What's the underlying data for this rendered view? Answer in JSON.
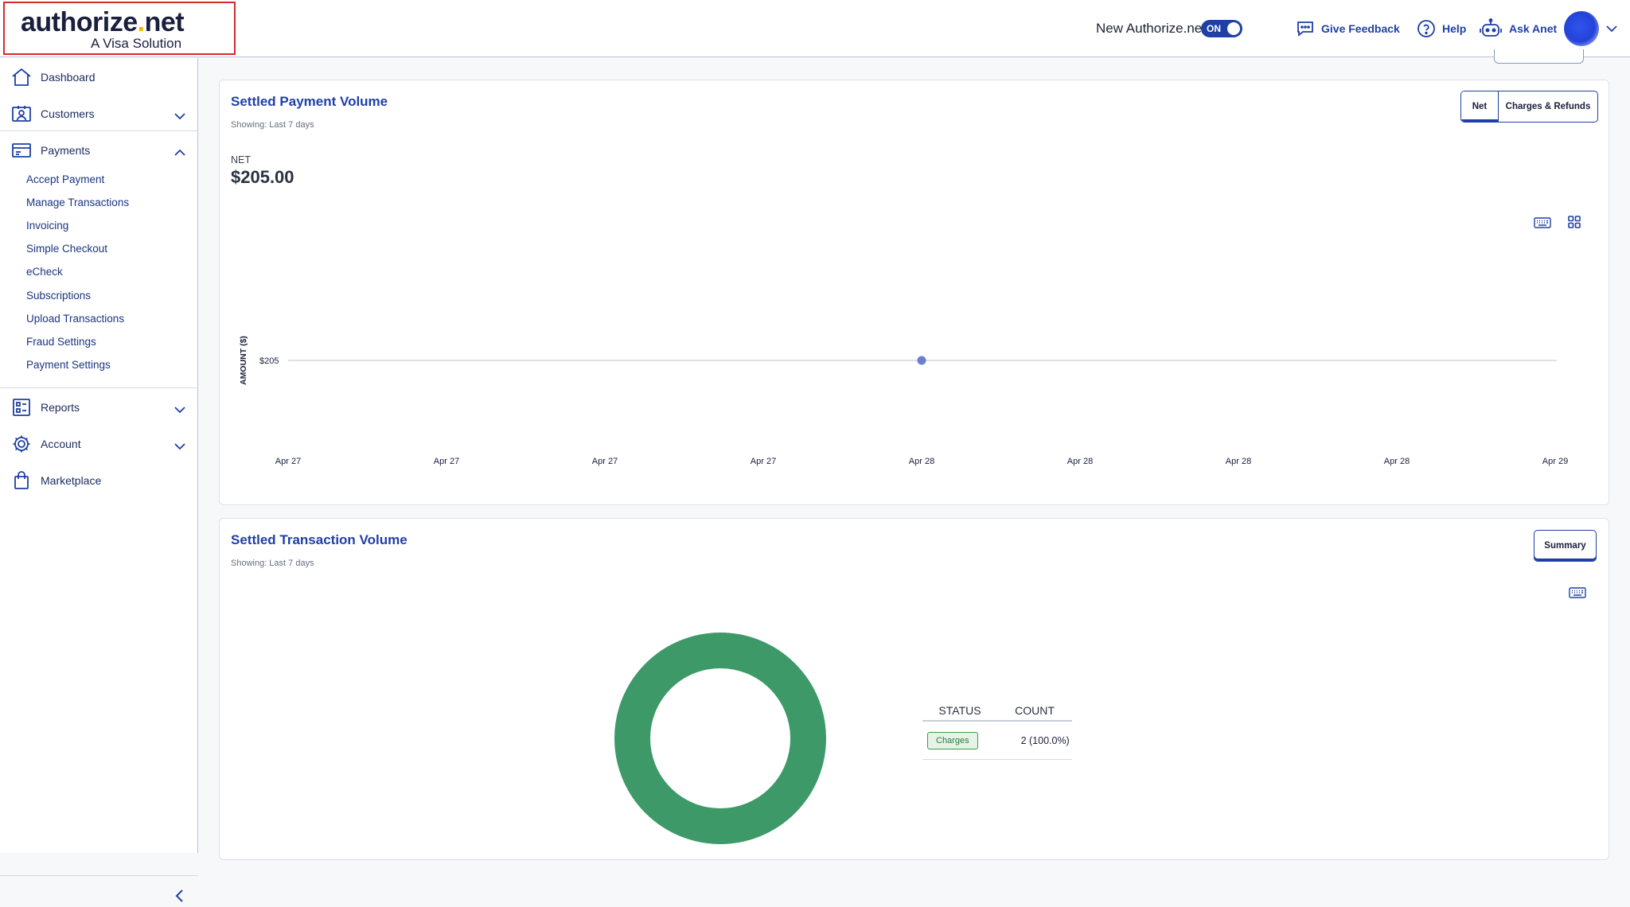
{
  "header": {
    "logo_main": "authorize",
    "logo_dot": ".",
    "logo_tld": "net",
    "logo_sub": "A Visa Solution",
    "toggle_label": "New Authorize.net",
    "toggle_state": "ON",
    "feedback": "Give Feedback",
    "help": "Help",
    "ask": "Ask Anet"
  },
  "sidebar": {
    "dashboard": "Dashboard",
    "customers": "Customers",
    "payments": "Payments",
    "payments_sub": [
      "Accept Payment",
      "Manage Transactions",
      "Invoicing",
      "Simple Checkout",
      "eCheck",
      "Subscriptions",
      "Upload Transactions",
      "Fraud Settings",
      "Payment Settings"
    ],
    "reports": "Reports",
    "account": "Account",
    "marketplace": "Marketplace"
  },
  "payment_volume": {
    "title": "Settled Payment Volume",
    "showing": "Showing: Last 7 days",
    "tab_net": "Net",
    "tab_charges": "Charges & Refunds",
    "net_label": "NET",
    "net_value": "$205.00"
  },
  "transaction_volume": {
    "title": "Settled Transaction Volume",
    "showing": "Showing: Last 7 days",
    "summary_btn": "Summary",
    "table_head_status": "STATUS",
    "table_head_count": "COUNT",
    "row_status": "Charges",
    "row_count": "2 (100.0%)"
  },
  "chart_data": [
    {
      "type": "line",
      "ylabel": "AMOUNT ($)",
      "x": [
        "Apr 27",
        "Apr 27",
        "Apr 27",
        "Apr 27",
        "Apr 28",
        "Apr 28",
        "Apr 28",
        "Apr 28",
        "Apr 29"
      ],
      "y_tick_labels": [
        "$205"
      ],
      "series": [
        {
          "x": "Apr 28",
          "y": 205
        }
      ],
      "color": "#6b7fd0",
      "grid": false
    },
    {
      "type": "pie",
      "donut": true,
      "categories": [
        "Charges"
      ],
      "values": [
        2
      ],
      "colors": [
        "#3d9a68"
      ]
    }
  ]
}
